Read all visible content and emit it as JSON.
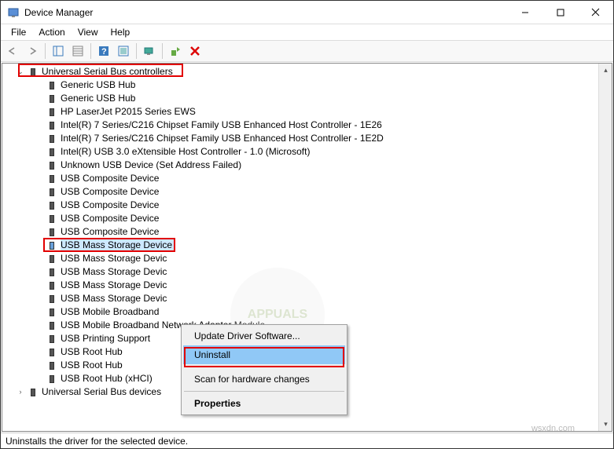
{
  "titlebar": {
    "title": "Device Manager"
  },
  "menubar": {
    "file": "File",
    "action": "Action",
    "view": "View",
    "help": "Help"
  },
  "tree": {
    "category": "Universal Serial Bus controllers",
    "items": [
      "Generic USB Hub",
      "Generic USB Hub",
      "HP LaserJet P2015 Series EWS",
      "Intel(R) 7 Series/C216 Chipset Family USB Enhanced Host Controller - 1E26",
      "Intel(R) 7 Series/C216 Chipset Family USB Enhanced Host Controller - 1E2D",
      "Intel(R) USB 3.0 eXtensible Host Controller - 1.0 (Microsoft)",
      "Unknown USB Device (Set Address Failed)",
      "USB Composite Device",
      "USB Composite Device",
      "USB Composite Device",
      "USB Composite Device",
      "USB Composite Device"
    ],
    "selected": "USB Mass Storage Device",
    "after": [
      "USB Mass Storage Devic",
      "USB Mass Storage Devic",
      "USB Mass Storage Devic",
      "USB Mass Storage Devic",
      "USB Mobile Broadband",
      "USB Mobile Broadband Network Adapter Module",
      "USB Printing Support",
      "USB Root Hub",
      "USB Root Hub",
      "USB Root Hub (xHCI)"
    ],
    "nextcat": "Universal Serial Bus devices"
  },
  "contextmenu": {
    "update": "Update Driver Software...",
    "uninstall": "Uninstall",
    "scan": "Scan for hardware changes",
    "properties": "Properties"
  },
  "statusbar": {
    "text": "Uninstalls the driver for the selected device."
  },
  "watermark": "wsxdn.com"
}
